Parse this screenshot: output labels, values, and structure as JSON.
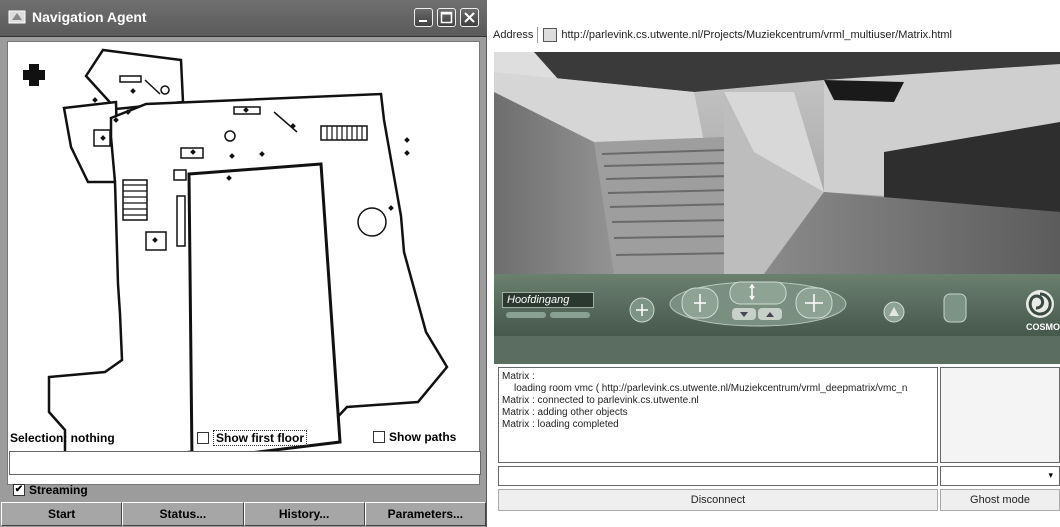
{
  "nav_window": {
    "title": "Navigation Agent",
    "title_icon": "app-icon",
    "controls": [
      "minimize-icon",
      "maximize-icon",
      "close-icon"
    ]
  },
  "status": {
    "selection": "Selection: nothing",
    "show_first_floor": {
      "label": "Show first floor",
      "checked": false
    },
    "show_paths": {
      "label": "Show paths",
      "checked": false
    }
  },
  "streaming": {
    "label": "Streaming",
    "checked": true
  },
  "buttons": {
    "start": "Start",
    "status": "Status...",
    "history": "History...",
    "parameters": "Parameters..."
  },
  "browser": {
    "address_label": "Address",
    "url": "http://parlevink.cs.utwente.nl/Projects/Muziekcentrum/vrml_multiuser/Matrix.html"
  },
  "vrml": {
    "viewpoint": "Hoofdingang",
    "logo_text": "COSMO",
    "icons": [
      "compass-icon",
      "walk-icon",
      "pan-icon",
      "rotate-icon",
      "tilt-icon",
      "seek-icon",
      "help-icon"
    ]
  },
  "chat": {
    "lines": [
      "Matrix :",
      "loading room vmc ( http://parlevink.cs.utwente.nl/Muziekcentrum/vrml_deepmatrix/vmc_n",
      "Matrix : connected to parlevink.cs.utwente.nl",
      "Matrix : adding other objects",
      "Matrix : loading completed"
    ],
    "input_value": "",
    "selected_mode": ""
  },
  "bottom_buttons": {
    "disconnect": "Disconnect",
    "ghost_mode": "Ghost mode"
  },
  "colors": {
    "nav_background": "#9c9c9c",
    "titlebar": "#5f5f5f",
    "cosmo_panel": "#56695c"
  }
}
